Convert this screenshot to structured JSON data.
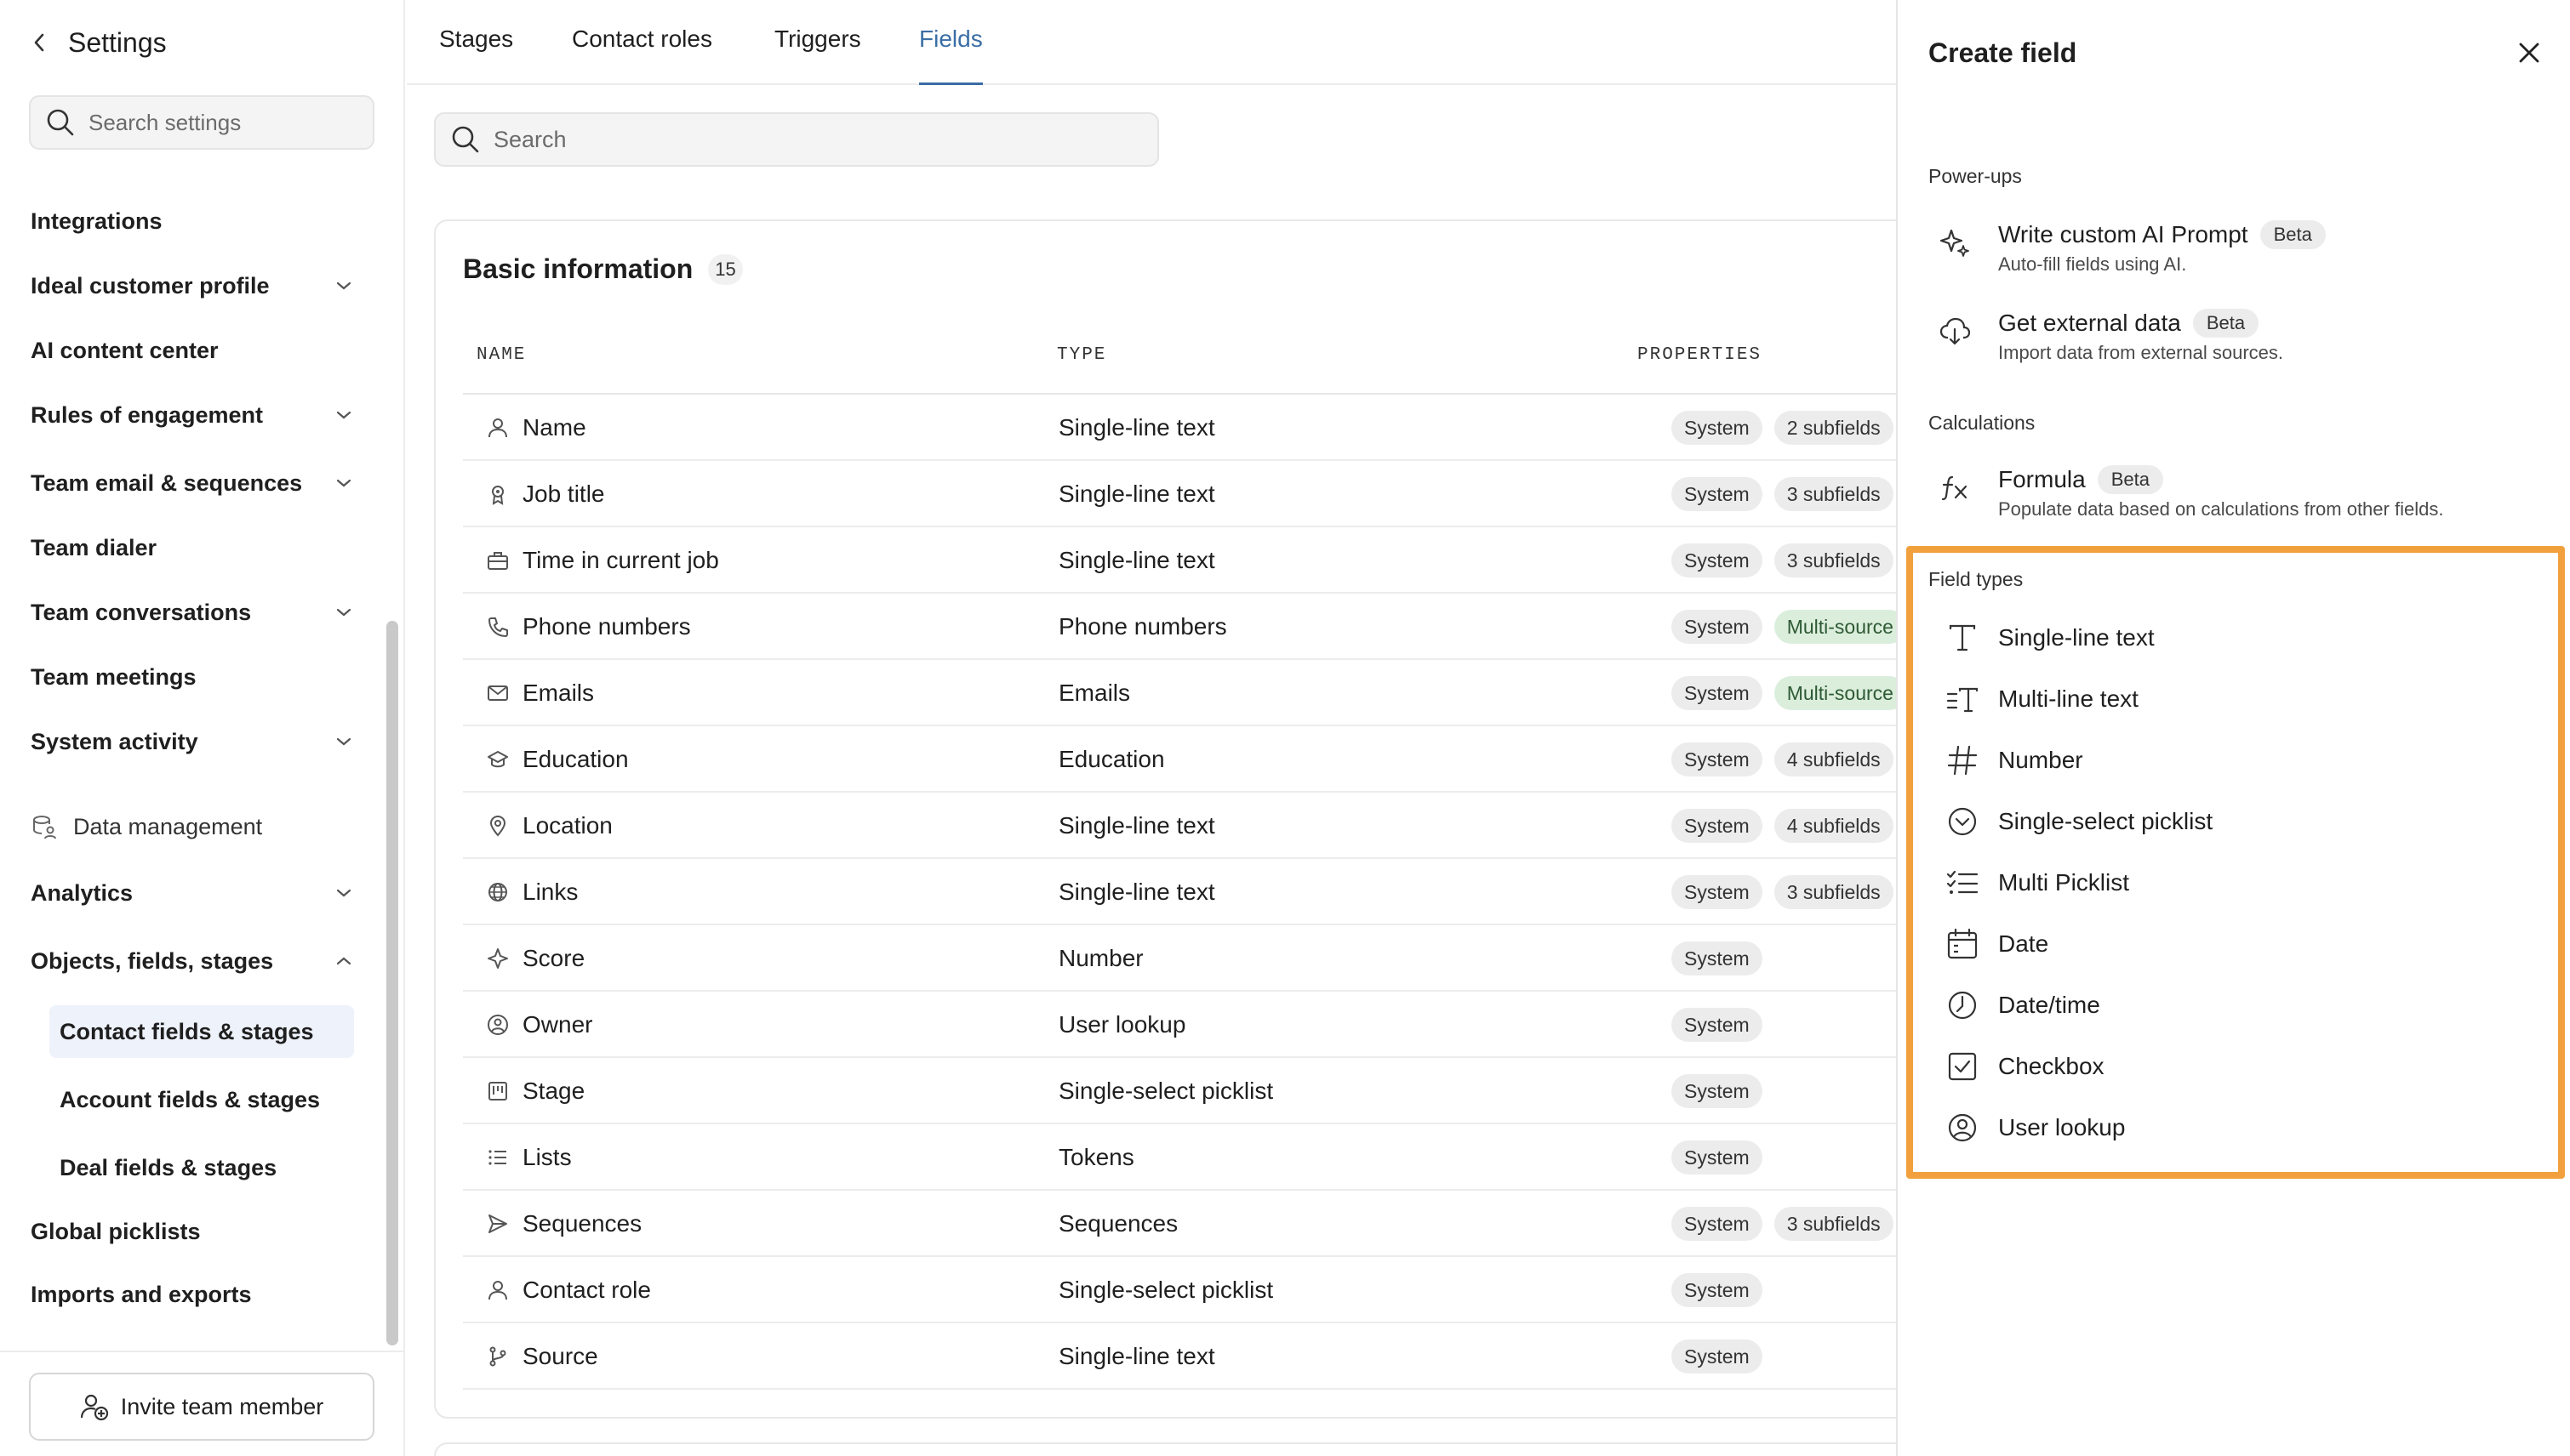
{
  "sidebar": {
    "title": "Settings",
    "search_placeholder": "Search settings",
    "items": [
      {
        "label": "Integrations"
      },
      {
        "label": "Ideal customer profile"
      },
      {
        "label": "AI content center"
      },
      {
        "label": "Rules of engagement"
      },
      {
        "label": "Team email & sequences"
      },
      {
        "label": "Team dialer"
      },
      {
        "label": "Team conversations"
      },
      {
        "label": "Team meetings"
      },
      {
        "label": "System activity"
      },
      {
        "label": "Data management"
      },
      {
        "label": "Analytics"
      },
      {
        "label": "Objects, fields, stages"
      },
      {
        "label": "Global picklists"
      },
      {
        "label": "Imports and exports"
      }
    ],
    "subitems": [
      {
        "label": "Contact fields & stages"
      },
      {
        "label": "Account fields & stages"
      },
      {
        "label": "Deal fields & stages"
      }
    ],
    "invite_label": "Invite team member"
  },
  "tabs": [
    {
      "label": "Stages"
    },
    {
      "label": "Contact roles"
    },
    {
      "label": "Triggers"
    },
    {
      "label": "Fields"
    }
  ],
  "main": {
    "search_placeholder": "Search",
    "section_title": "Basic information",
    "section_count": "15",
    "columns": [
      "NAME",
      "TYPE",
      "PROPERTIES"
    ],
    "rows": [
      {
        "name": "Name",
        "type": "Single-line text",
        "p1": "System",
        "p2": "2 subfields",
        "icon": "person-icon"
      },
      {
        "name": "Job title",
        "type": "Single-line text",
        "p1": "System",
        "p2": "3 subfields",
        "icon": "badge-icon"
      },
      {
        "name": "Time in current job",
        "type": "Single-line text",
        "p1": "System",
        "p2": "3 subfields",
        "icon": "briefcase-icon"
      },
      {
        "name": "Phone numbers",
        "type": "Phone numbers",
        "p1": "System",
        "p2": "Multi-source",
        "icon": "phone-icon"
      },
      {
        "name": "Emails",
        "type": "Emails",
        "p1": "System",
        "p2": "Multi-source",
        "icon": "mail-icon"
      },
      {
        "name": "Education",
        "type": "Education",
        "p1": "System",
        "p2": "4 subfields",
        "icon": "graduation-icon"
      },
      {
        "name": "Location",
        "type": "Single-line text",
        "p1": "System",
        "p2": "4 subfields",
        "icon": "pin-icon"
      },
      {
        "name": "Links",
        "type": "Single-line text",
        "p1": "System",
        "p2": "3 subfields",
        "icon": "globe-icon"
      },
      {
        "name": "Score",
        "type": "Number",
        "p1": "System",
        "p2": "",
        "icon": "score-icon"
      },
      {
        "name": "Owner",
        "type": "User lookup",
        "p1": "System",
        "p2": "",
        "icon": "user-circle-icon"
      },
      {
        "name": "Stage",
        "type": "Single-select picklist",
        "p1": "System",
        "p2": "",
        "icon": "kanban-icon"
      },
      {
        "name": "Lists",
        "type": "Tokens",
        "p1": "System",
        "p2": "",
        "icon": "list-icon"
      },
      {
        "name": "Sequences",
        "type": "Sequences",
        "p1": "System",
        "p2": "3 subfields",
        "icon": "send-icon"
      },
      {
        "name": "Contact role",
        "type": "Single-select picklist",
        "p1": "System",
        "p2": "",
        "icon": "person-icon"
      },
      {
        "name": "Source",
        "type": "Single-line text",
        "p1": "System",
        "p2": "",
        "icon": "branch-icon"
      }
    ]
  },
  "panel": {
    "title": "Create field",
    "powerups_label": "Power-ups",
    "calculations_label": "Calculations",
    "fieldtypes_label": "Field types",
    "powerups": [
      {
        "title": "Write custom AI Prompt",
        "badge": "Beta",
        "desc": "Auto-fill fields using AI."
      },
      {
        "title": "Get external data",
        "badge": "Beta",
        "desc": "Import data from external sources."
      }
    ],
    "calculations": [
      {
        "title": "Formula",
        "badge": "Beta",
        "desc": "Populate data based on calculations from other fields."
      }
    ],
    "field_types": [
      {
        "label": "Single-line text",
        "icon": "text-icon"
      },
      {
        "label": "Multi-line text",
        "icon": "multiline-text-icon"
      },
      {
        "label": "Number",
        "icon": "hash-icon"
      },
      {
        "label": "Single-select picklist",
        "icon": "chevron-circle-icon"
      },
      {
        "label": "Multi Picklist",
        "icon": "checklist-icon"
      },
      {
        "label": "Date",
        "icon": "calendar-icon"
      },
      {
        "label": "Date/time",
        "icon": "clock-icon"
      },
      {
        "label": "Checkbox",
        "icon": "checkbox-icon"
      },
      {
        "label": "User lookup",
        "icon": "user-circle-icon"
      }
    ],
    "highlight_color": "#f2a03d"
  },
  "colors": {
    "accent": "#3a6ea5",
    "active_bg": "#eef2fb",
    "pill_green": "#dbeedc"
  }
}
